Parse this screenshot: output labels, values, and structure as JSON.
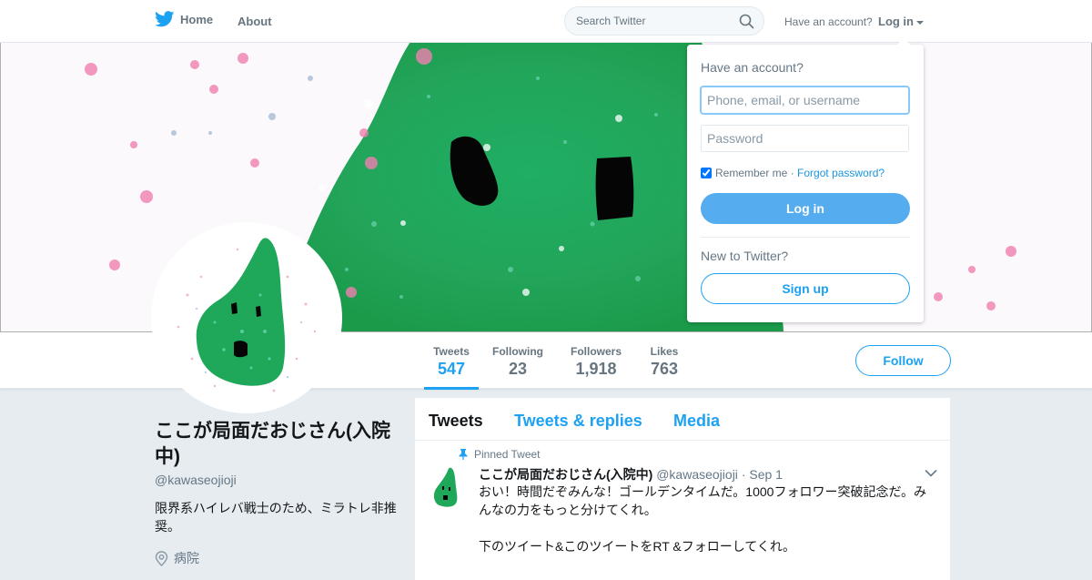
{
  "nav": {
    "home_label": "Home",
    "about_label": "About",
    "search_placeholder": "Search Twitter",
    "have_account": "Have an account?",
    "login_label": "Log in"
  },
  "login_dropdown": {
    "title": "Have an account?",
    "username_placeholder": "Phone, email, or username",
    "password_placeholder": "Password",
    "remember_me": "Remember me",
    "separator": "·",
    "forgot_password": "Forgot password?",
    "login_button": "Log in",
    "new_to_twitter": "New to Twitter?",
    "signup_button": "Sign up"
  },
  "stats": [
    {
      "label": "Tweets",
      "value": "547"
    },
    {
      "label": "Following",
      "value": "23"
    },
    {
      "label": "Followers",
      "value": "1,918"
    },
    {
      "label": "Likes",
      "value": "763"
    }
  ],
  "follow_button": "Follow",
  "profile": {
    "name": "ここが局面だおじさん(入院中)",
    "handle": "@kawaseojioji",
    "bio": "限界系ハイレバ戦士のため、ミラトレ非推奨。",
    "location": "病院"
  },
  "timeline": {
    "tabs": [
      "Tweets",
      "Tweets & replies",
      "Media"
    ],
    "pinned_label": "Pinned Tweet",
    "tweet": {
      "name": "ここが局面だおじさん(入院中)",
      "handle": "@kawaseojioji",
      "separator": "·",
      "date": "Sep 1",
      "text_1": "おい！時間だぞみんな！ゴールデンタイムだ。1000フォロワー突破記念だ。みんなの力をもっと分けてくれ。",
      "text_2": "下のツイート&このツイートをRT &フォローしてくれ。"
    }
  },
  "colors": {
    "accent": "#1da1f2",
    "login_button_bg": "#55acee",
    "page_bg": "#e6ecf0",
    "banner_green": "#2eb85c"
  },
  "icons": {
    "logo": "twitter-bird-icon",
    "search": "search-icon",
    "pin": "pin-icon",
    "location": "location-pin-icon",
    "chevron": "chevron-down-icon"
  }
}
